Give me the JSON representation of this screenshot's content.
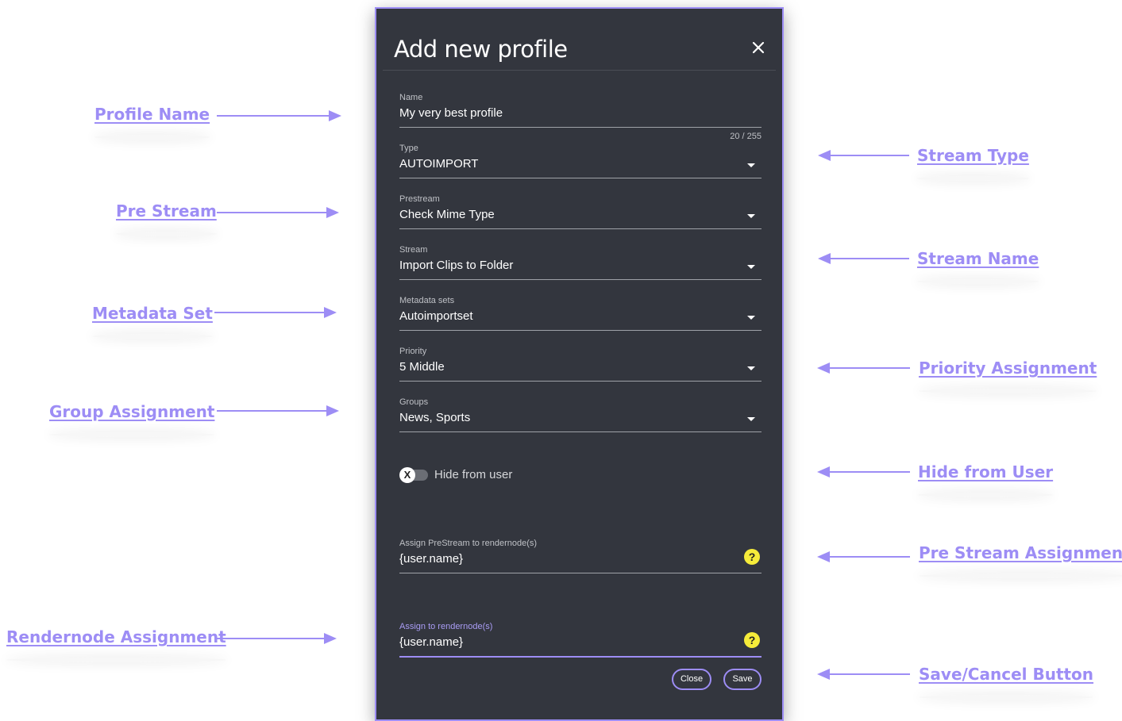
{
  "dialog": {
    "title": "Add new profile",
    "fields": {
      "name": {
        "label": "Name",
        "value": "My very best profile",
        "counter": "20 / 255"
      },
      "type": {
        "label": "Type",
        "value": "AUTOIMPORT"
      },
      "prestream": {
        "label": "Prestream",
        "value": "Check Mime Type"
      },
      "stream": {
        "label": "Stream",
        "value": "Import Clips to Folder"
      },
      "metadata_sets": {
        "label": "Metadata sets",
        "value": "Autoimportset"
      },
      "priority": {
        "label": "Priority",
        "value": "5 Middle"
      },
      "groups": {
        "label": "Groups",
        "value": "News, Sports"
      },
      "prestream_rendernode": {
        "label": "Assign PreStream to rendernode(s)",
        "value": "{user.name}",
        "help": "?"
      },
      "rendernode": {
        "label": "Assign to rendernode(s)",
        "value": "{user.name}",
        "help": "?"
      }
    },
    "toggle": {
      "label": "Hide from user",
      "knob": "X"
    },
    "buttons": {
      "close": "Close",
      "save": "Save"
    }
  },
  "annotations": {
    "profile_name": "Profile Name",
    "pre_stream": "Pre Stream",
    "metadata_set": "Metadata Set",
    "group_assignment": "Group Assignment",
    "rendernode_assignment": "Rendernode Assignment",
    "stream_type": "Stream Type",
    "stream_name": "Stream Name",
    "priority_assignment": "Priority Assignment",
    "hide_from_user": "Hide from User",
    "pre_stream_assignment": "Pre Stream Assignment",
    "save_cancel_button": "Save/Cancel Button"
  },
  "colors": {
    "accent": "#9d8df5",
    "dialog_bg": "#33363e",
    "help_icon": "#f6ec3a"
  }
}
